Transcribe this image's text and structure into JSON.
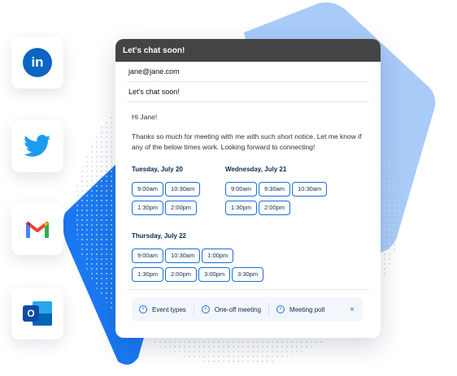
{
  "colors": {
    "blue_light": "#a8cbf8",
    "blue_dark": "#1a79f2",
    "header_bg": "#444444",
    "accent": "#1a6fd8"
  },
  "apps": [
    {
      "icon": "linkedin-icon",
      "text": "in"
    },
    {
      "icon": "twitter-icon"
    },
    {
      "icon": "gmail-icon"
    },
    {
      "icon": "outlook-icon",
      "text": "O"
    }
  ],
  "email": {
    "header_title": "Let's chat soon!",
    "to": "jane@jane.com",
    "subject": "Let's chat soon!",
    "greeting": "Hi Jane!",
    "message": "Thanks so much for meeting with me with such short notice. Let me know if any of the below times work. Looking forward to connecting!"
  },
  "days": [
    {
      "label": "Tuesday, July 20",
      "slots": [
        "9:00am",
        "10:30am",
        "1:30pm",
        "2:00pm"
      ]
    },
    {
      "label": "Wednesday, July 21",
      "slots": [
        "9:00am",
        "9:30am",
        "10:30am",
        "1:30pm",
        "2:00pm"
      ]
    },
    {
      "label": "Thursday, July 22",
      "slots": [
        "9:00am",
        "10:30am",
        "1:00pm",
        "1:30pm",
        "2:00pm",
        "3:00pm",
        "3:30pm"
      ]
    }
  ],
  "toolbar": {
    "event_types": "Event types",
    "one_off_meeting": "One-off meeting",
    "meeting_poll": "Meeting poll",
    "close": "×"
  }
}
